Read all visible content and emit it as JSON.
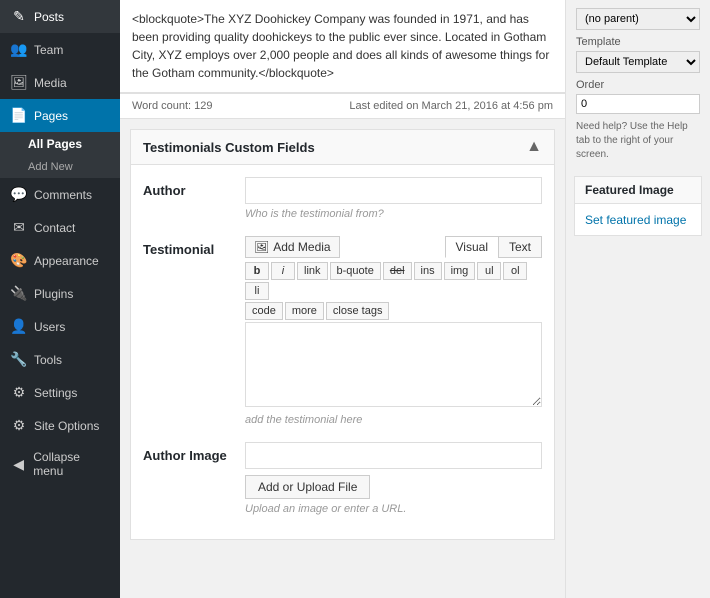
{
  "sidebar": {
    "items": [
      {
        "label": "Posts",
        "icon": "✎",
        "active": false,
        "name": "posts"
      },
      {
        "label": "Team",
        "icon": "👥",
        "active": false,
        "name": "team"
      },
      {
        "label": "Media",
        "icon": "🖼",
        "active": false,
        "name": "media"
      },
      {
        "label": "Pages",
        "icon": "📄",
        "active": true,
        "name": "pages"
      },
      {
        "label": "Comments",
        "icon": "💬",
        "active": false,
        "name": "comments"
      },
      {
        "label": "Contact",
        "icon": "✉",
        "active": false,
        "name": "contact"
      },
      {
        "label": "Appearance",
        "icon": "🎨",
        "active": false,
        "name": "appearance"
      },
      {
        "label": "Plugins",
        "icon": "🔌",
        "active": false,
        "name": "plugins"
      },
      {
        "label": "Users",
        "icon": "👤",
        "active": false,
        "name": "users"
      },
      {
        "label": "Tools",
        "icon": "🔧",
        "active": false,
        "name": "tools"
      },
      {
        "label": "Settings",
        "icon": "⚙",
        "active": false,
        "name": "settings"
      },
      {
        "label": "Site Options",
        "icon": "⚙",
        "active": false,
        "name": "site-options"
      }
    ],
    "pages_sub": {
      "all_pages": "All Pages",
      "add_new": "Add New"
    },
    "collapse": "Collapse menu"
  },
  "blockquote": {
    "text": "<blockquote>The XYZ Doohickey Company was founded in 1971, and has been providing quality doohickeys to the public ever since. Located in Gotham City, XYZ employs over 2,000 people and does all kinds of awesome things for the Gotham community.</blockquote>"
  },
  "word_count_bar": {
    "word_count": "Word count: 129",
    "last_edited": "Last edited on March 21, 2016 at 4:56 pm"
  },
  "custom_fields": {
    "title": "Testimonials Custom Fields",
    "author_label": "Author",
    "author_placeholder": "",
    "author_hint": "Who is the testimonial from?",
    "testimonial_label": "Testimonial",
    "add_media_btn": "Add Media",
    "view_visual": "Visual",
    "view_text": "Text",
    "format_buttons": [
      "b",
      "i",
      "link",
      "b-quote",
      "del",
      "ins",
      "img",
      "ul",
      "ol",
      "li",
      "code",
      "more",
      "close tags"
    ],
    "editor_placeholder": "add the testimonial here",
    "author_image_label": "Author Image",
    "author_image_input": "",
    "upload_btn": "Add or Upload File",
    "upload_hint": "Upload an image or enter a URL."
  },
  "right_sidebar": {
    "no_parent_label": "(no parent)",
    "template_label": "Template",
    "template_value": "Default Template",
    "order_label": "Order",
    "order_value": "0",
    "help_text": "Need help? Use the Help tab to the right of your screen.",
    "featured_image_title": "Featured Image",
    "set_featured_link": "Set featured image"
  }
}
